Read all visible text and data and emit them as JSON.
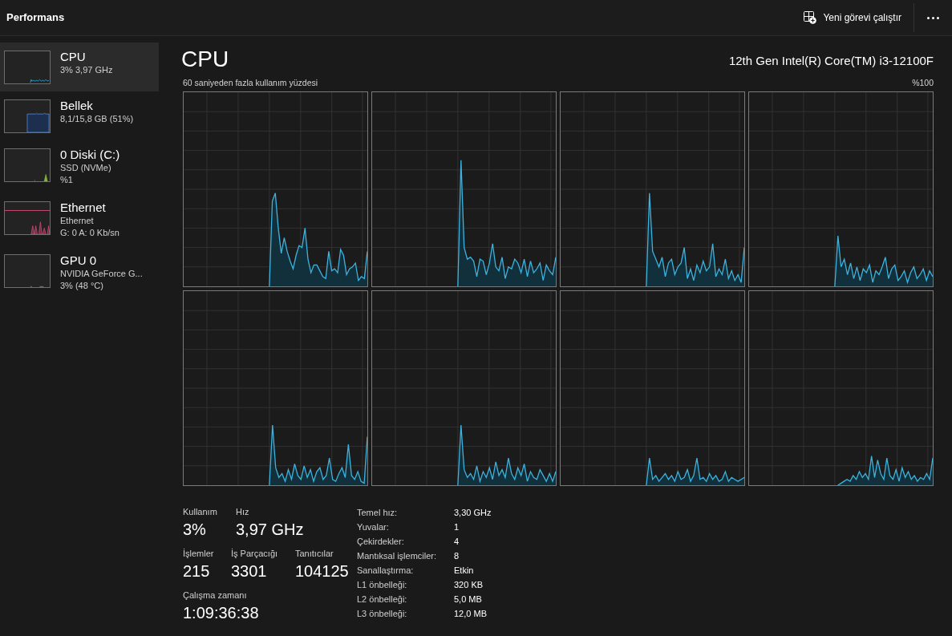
{
  "header": {
    "title": "Performans",
    "new_task_button": {
      "label": "Yeni görevi çalıştır"
    }
  },
  "sidebar": {
    "items": [
      {
        "kind": "cpu",
        "title": "CPU",
        "details": [
          "3% 3,97 GHz"
        ],
        "selected": true
      },
      {
        "kind": "memory",
        "title": "Bellek",
        "details": [
          "8,1/15,8 GB (51%)"
        ],
        "selected": false
      },
      {
        "kind": "disk",
        "title": "0 Diski (C:)",
        "details": [
          "SSD (NVMe)",
          "%1"
        ],
        "selected": false
      },
      {
        "kind": "network",
        "title": "Ethernet",
        "details": [
          "Ethernet",
          "G: 0 A: 0 Kb/sn"
        ],
        "selected": false
      },
      {
        "kind": "gpu",
        "title": "GPU 0",
        "details": [
          "NVIDIA GeForce G...",
          "3% (48 °C)"
        ],
        "selected": false
      }
    ]
  },
  "cpu_panel": {
    "title": "CPU",
    "processor": "12th Gen Intel(R) Core(TM) i3-12100F",
    "graph_caption": "60 saniyeden fazla kullanım yüzdesi",
    "graph_max_label": "%100",
    "stat_rows": [
      [
        {
          "label": "Kullanım",
          "value": "3%"
        },
        {
          "label": "Hız",
          "value": "3,97 GHz"
        }
      ],
      [
        {
          "label": "İşlemler",
          "value": "215"
        },
        {
          "label": "İş Parçacığı",
          "value": "3301"
        },
        {
          "label": "Tanıtıcılar",
          "value": "104125"
        }
      ],
      [
        {
          "label": "Çalışma zamanı",
          "value": "1:09:36:38"
        }
      ]
    ],
    "specs": [
      {
        "label": "Temel hız:",
        "value": "3,30 GHz"
      },
      {
        "label": "Yuvalar:",
        "value": "1"
      },
      {
        "label": "Çekirdekler:",
        "value": "4"
      },
      {
        "label": "Mantıksal işlemciler:",
        "value": "8"
      },
      {
        "label": "Sanallaştırma:",
        "value": "Etkin"
      },
      {
        "label": "L1 önbelleği:",
        "value": "320 KB"
      },
      {
        "label": "L2 önbelleği:",
        "value": "5,0 MB"
      },
      {
        "label": "L3 önbelleği:",
        "value": "12,0 MB"
      }
    ]
  }
}
